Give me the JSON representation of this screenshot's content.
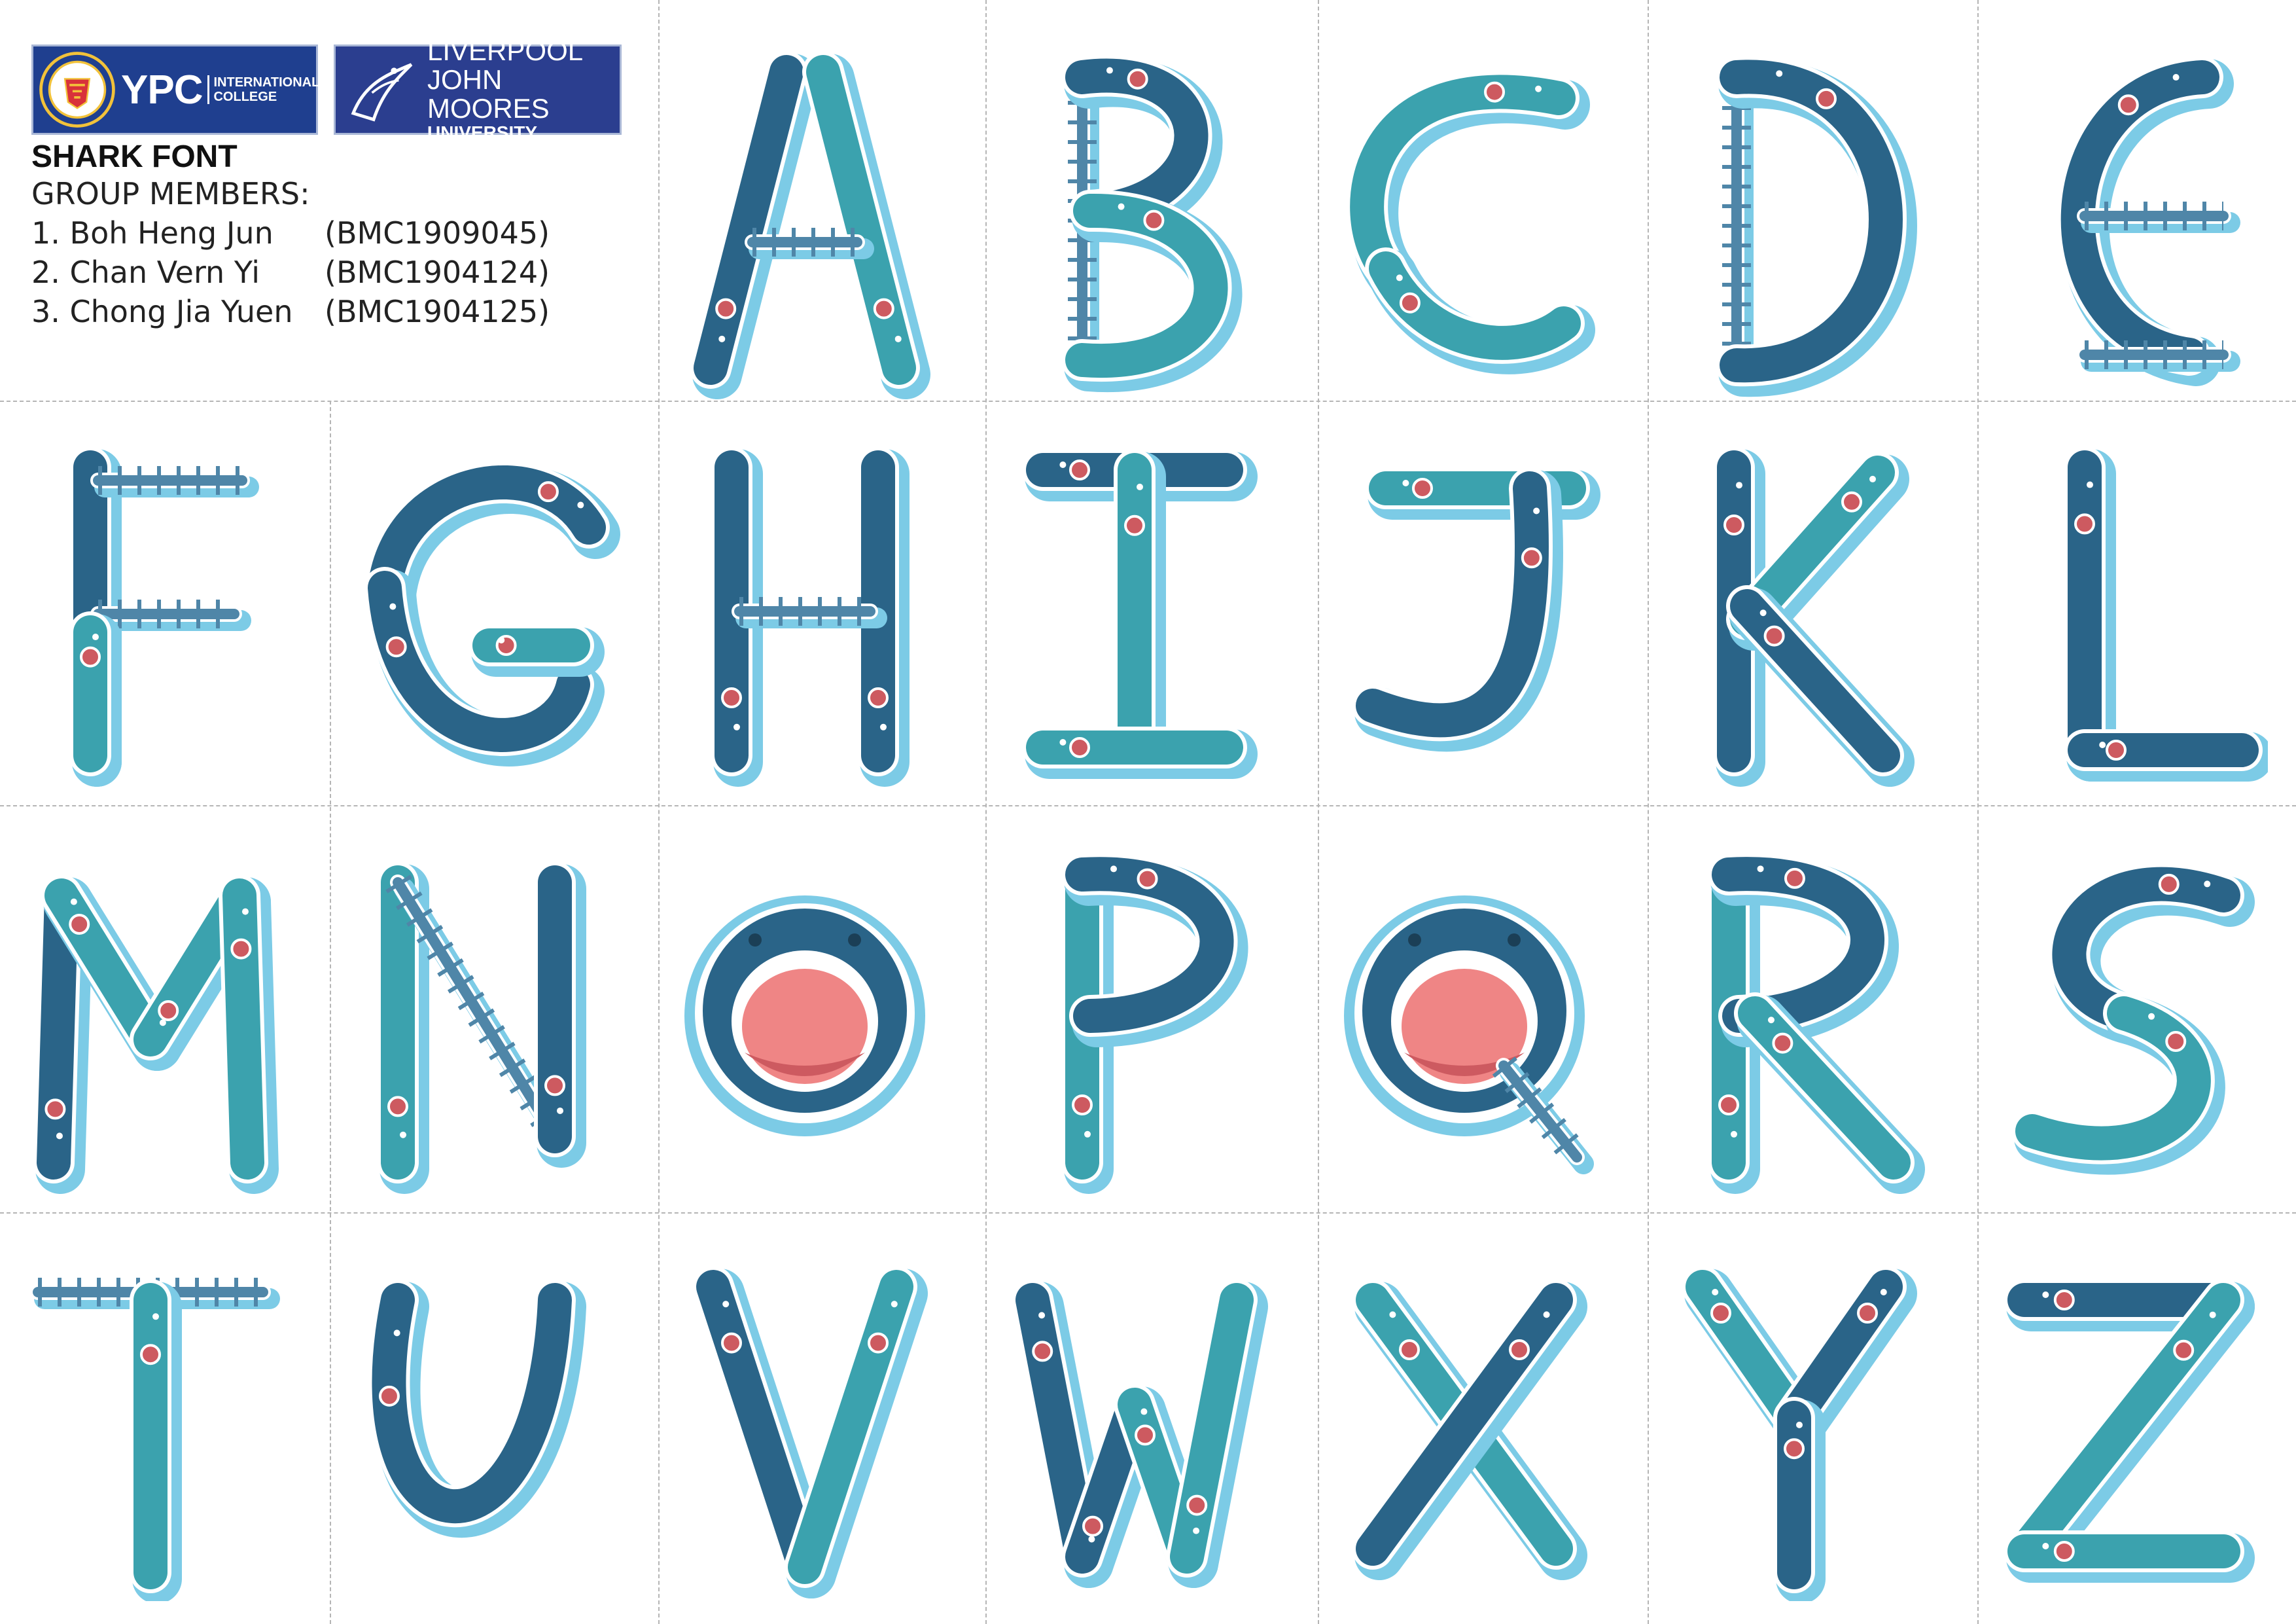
{
  "header": {
    "logo_ypc": {
      "main": "YPC",
      "sub_line1": "INTERNATIONAL",
      "sub_line2": "COLLEGE"
    },
    "logo_ljmu": {
      "line1": "LIVERPOOL",
      "line2": "JOHN MOORES",
      "line3": "UNIVERSITY"
    },
    "title": "SHARK FONT",
    "members_heading": "GROUP MEMBERS:",
    "members": [
      {
        "name": "1. Boh Heng Jun",
        "id": "(BMC1909045)"
      },
      {
        "name": "2. Chan Vern Yi",
        "id": "(BMC1904124)"
      },
      {
        "name": "3. Chong Jia Yuen",
        "id": "(BMC1904125)"
      }
    ]
  },
  "colors": {
    "dark_shark": "#2a6488",
    "teal_shark": "#3ba2ae",
    "outline": "#7ccbe6",
    "mouth": "#ef8585",
    "mouth_dark": "#cd5a60",
    "grid_line": "#b5b5b5"
  },
  "letters": [
    "A",
    "B",
    "C",
    "D",
    "E",
    "F",
    "G",
    "H",
    "I",
    "J",
    "K",
    "L",
    "M",
    "N",
    "O",
    "P",
    "Q",
    "R",
    "S",
    "T",
    "U",
    "V",
    "W",
    "X",
    "Y",
    "Z"
  ]
}
